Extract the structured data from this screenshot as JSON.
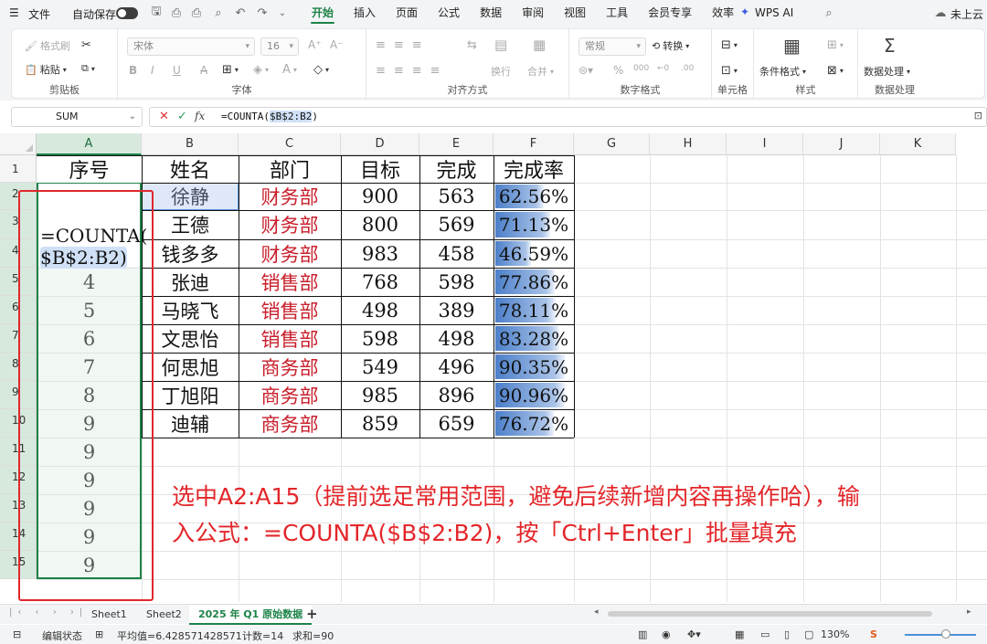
{
  "menubar": {
    "file": "文件",
    "autosave": "自动保存",
    "tabs": [
      "开始",
      "插入",
      "页面",
      "公式",
      "数据",
      "审阅",
      "视图",
      "工具",
      "会员专享",
      "效率"
    ],
    "active_tab": "开始",
    "wps_ai": "WPS AI",
    "cloud": "未上云"
  },
  "ribbon": {
    "format_painter": "格式刷",
    "paste": "粘贴",
    "clipboard_label": "剪贴板",
    "font_name": "宋体",
    "font_size": "16",
    "font_label": "字体",
    "wrap": "换行",
    "merge": "合并",
    "align_label": "对齐方式",
    "number_format": "常规",
    "convert": "转换",
    "number_label": "数字格式",
    "cell_label": "单元格",
    "cond_format": "条件格式",
    "style_label": "样式",
    "data_process": "数据处理",
    "data_label": "数据处理"
  },
  "formula_bar": {
    "name_box": "SUM",
    "prefix": "=COUNTA(",
    "ref": "$B$2:B2",
    "suffix": ")"
  },
  "columns": [
    "A",
    "B",
    "C",
    "D",
    "E",
    "F",
    "G",
    "H",
    "I",
    "J",
    "K"
  ],
  "rows": [
    "1",
    "2",
    "3",
    "4",
    "5",
    "6",
    "7",
    "8",
    "9",
    "10",
    "11",
    "12",
    "13",
    "14",
    "15"
  ],
  "table": {
    "headers": [
      "序号",
      "姓名",
      "部门",
      "目标",
      "完成",
      "完成率"
    ],
    "edit_line1": "=COUNTA(",
    "edit_line2": "$B$2:B2)",
    "rows": [
      {
        "no": "",
        "name": "徐静",
        "dept": "财务部",
        "target": "900",
        "done": "563",
        "rate": "62.56%",
        "rate_value": 0.6256
      },
      {
        "no": "",
        "name": "王德",
        "dept": "财务部",
        "target": "800",
        "done": "569",
        "rate": "71.13%",
        "rate_value": 0.7113
      },
      {
        "no": "",
        "name": "钱多多",
        "dept": "财务部",
        "target": "983",
        "done": "458",
        "rate": "46.59%",
        "rate_value": 0.4659
      },
      {
        "no": "4",
        "name": "张迪",
        "dept": "销售部",
        "target": "768",
        "done": "598",
        "rate": "77.86%",
        "rate_value": 0.7786
      },
      {
        "no": "5",
        "name": "马晓飞",
        "dept": "销售部",
        "target": "498",
        "done": "389",
        "rate": "78.11%",
        "rate_value": 0.7811
      },
      {
        "no": "6",
        "name": "文思怡",
        "dept": "销售部",
        "target": "598",
        "done": "498",
        "rate": "83.28%",
        "rate_value": 0.8328
      },
      {
        "no": "7",
        "name": "何思旭",
        "dept": "商务部",
        "target": "549",
        "done": "496",
        "rate": "90.35%",
        "rate_value": 0.9035
      },
      {
        "no": "8",
        "name": "丁旭阳",
        "dept": "商务部",
        "target": "985",
        "done": "896",
        "rate": "90.96%",
        "rate_value": 0.9096
      },
      {
        "no": "9",
        "name": "迪辅",
        "dept": "商务部",
        "target": "859",
        "done": "659",
        "rate": "76.72%",
        "rate_value": 0.7672
      }
    ],
    "extra_no": [
      "9",
      "9",
      "9",
      "9",
      "9"
    ]
  },
  "annotation": {
    "line1": "选中A2:A15（提前选足常用范围，避免后续新增内容再操作哈），输",
    "line2": "入公式：=COUNTA($B$2:B2)，按「Ctrl+Enter」批量填充"
  },
  "sheets": [
    "Sheet1",
    "Sheet2",
    "2025 年 Q1 原始数据"
  ],
  "active_sheet": "2025 年 Q1 原始数据",
  "status": {
    "mode": "编辑状态",
    "average": "平均值=6.428571428571",
    "count": "计数=14",
    "sum": "求和=90",
    "zoom": "130%"
  },
  "colors": {
    "accent": "#1d8348",
    "annotation": "#e3262a",
    "dept_text": "#c8202c",
    "bar": "#4c7fc9"
  }
}
